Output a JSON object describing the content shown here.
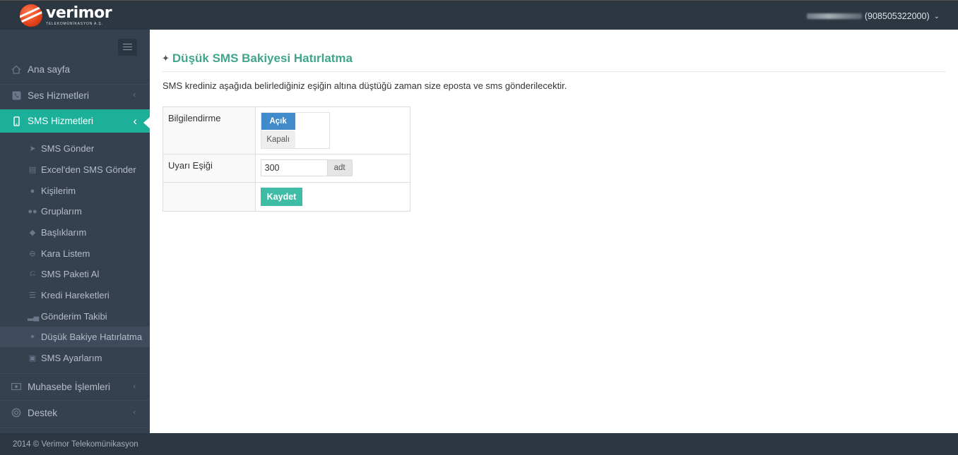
{
  "header": {
    "logo_name": "verimor",
    "logo_sub": "TELEKOMÜNİKASYON A.Ş.",
    "user_phone": "(908505322000)"
  },
  "sidebar": {
    "top_items": [
      {
        "label": "Ana sayfa",
        "icon": "home-icon"
      },
      {
        "label": "Ses Hizmetleri",
        "icon": "phone-icon"
      },
      {
        "label": "SMS Hizmetleri",
        "icon": "mobile-icon"
      }
    ],
    "sub_items": [
      {
        "label": "SMS Gönder",
        "icon": "send-icon"
      },
      {
        "label": "Excel'den SMS Gönder",
        "icon": "file-excel-icon"
      },
      {
        "label": "Kişilerim",
        "icon": "user-icon"
      },
      {
        "label": "Gruplarım",
        "icon": "users-icon"
      },
      {
        "label": "Başlıklarım",
        "icon": "tags-icon"
      },
      {
        "label": "Kara Listem",
        "icon": "minus-circle-icon"
      },
      {
        "label": "SMS Paketi Al",
        "icon": "cart-icon"
      },
      {
        "label": "Kredi Hareketleri",
        "icon": "list-icon"
      },
      {
        "label": "Gönderim Takibi",
        "icon": "bar-chart-icon"
      },
      {
        "label": "Düşük Bakiye Hatırlatma",
        "icon": "pin-icon"
      },
      {
        "label": "SMS Ayarlarım",
        "icon": "settings-file-icon"
      }
    ],
    "bottom_items": [
      {
        "label": "Muhasebe İşlemleri",
        "icon": "money-icon"
      },
      {
        "label": "Destek",
        "icon": "lifebuoy-icon"
      }
    ]
  },
  "main": {
    "title": "Düşük SMS Bakiyesi Hatırlatma",
    "description": "SMS krediniz aşağıda belirlediğiniz eşiğin altına düştüğü zaman size eposta ve sms gönderilecektir.",
    "form": {
      "notify_label": "Bilgilendirme",
      "switch_on": "Açık",
      "switch_off": "Kapalı",
      "threshold_label": "Uyarı Eşiği",
      "threshold_value": "300",
      "threshold_unit": "adt",
      "save_label": "Kaydet"
    }
  },
  "footer": {
    "text": "2014 © Verimor Telekomünikasyon"
  },
  "colors": {
    "sidebar_bg": "#364150",
    "header_bg": "#2c3742",
    "active_bg": "#1caf9a",
    "title_color": "#3fa68b",
    "switch_on_bg": "#428bca",
    "save_bg": "#3fbca5"
  }
}
